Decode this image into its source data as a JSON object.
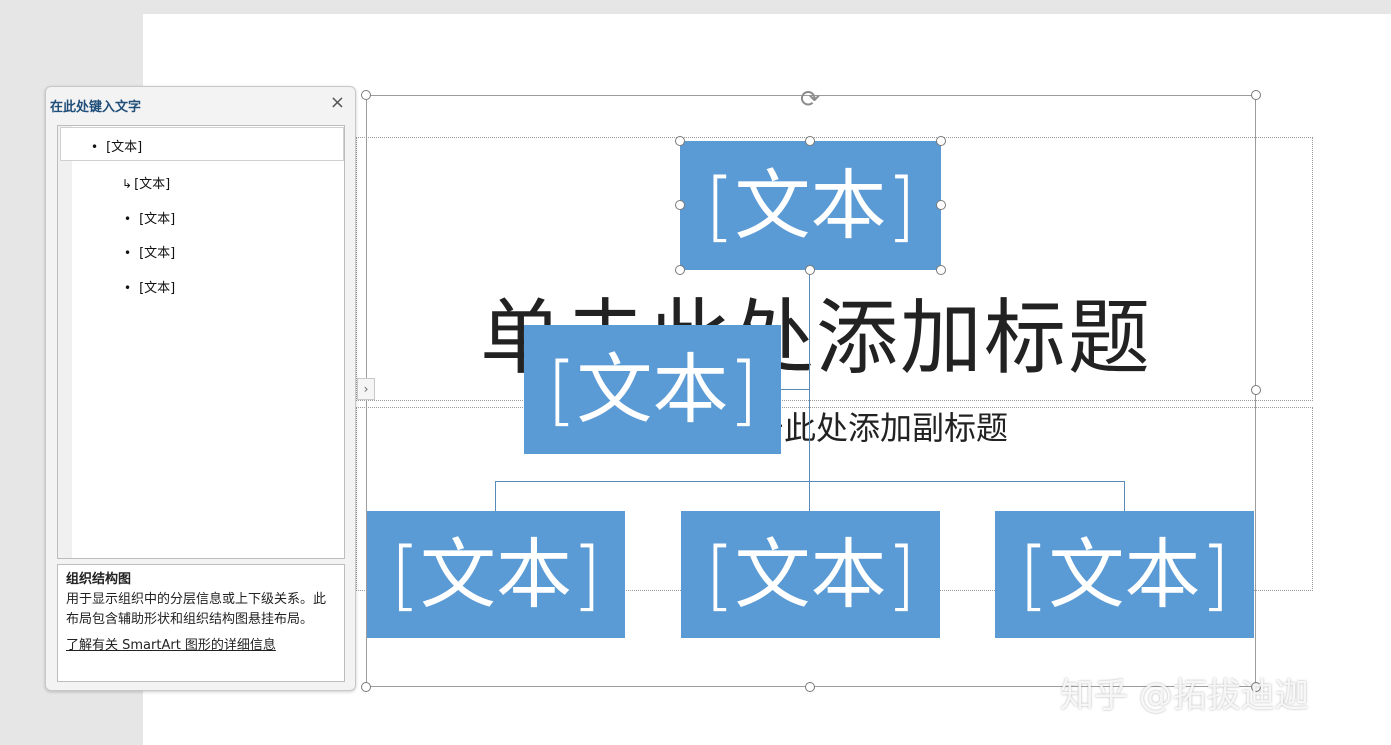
{
  "text_pane": {
    "title": "在此处键入文字",
    "close_glyph": "×",
    "items": [
      {
        "level": 1,
        "bullet": "•",
        "label": "[文本]"
      },
      {
        "level": 2,
        "bullet": "↳",
        "label": "[文本]"
      },
      {
        "level": 2,
        "bullet": "•",
        "label": "[文本]"
      },
      {
        "level": 2,
        "bullet": "•",
        "label": "[文本]"
      },
      {
        "level": 2,
        "bullet": "•",
        "label": "[文本]"
      }
    ],
    "description": {
      "title": "组织结构图",
      "body": "用于显示组织中的分层信息或上下级关系。此布局包含辅助形状和组织结构图悬挂布局。",
      "link": "了解有关 SmartArt 图形的详细信息"
    },
    "expand_glyph": "›"
  },
  "slide": {
    "title_placeholder": "单击此处添加标题",
    "subtitle_placeholder": "单击此处添加副标题"
  },
  "smartart": {
    "rotate_glyph": "⟳",
    "fill_color": "#5b9bd5",
    "nodes": {
      "top": "[文本]",
      "assistant": "[文本]",
      "child_1": "[文本]",
      "child_2": "[文本]",
      "child_3": "[文本]"
    }
  },
  "watermark": "知乎 @拓拔迪迦"
}
